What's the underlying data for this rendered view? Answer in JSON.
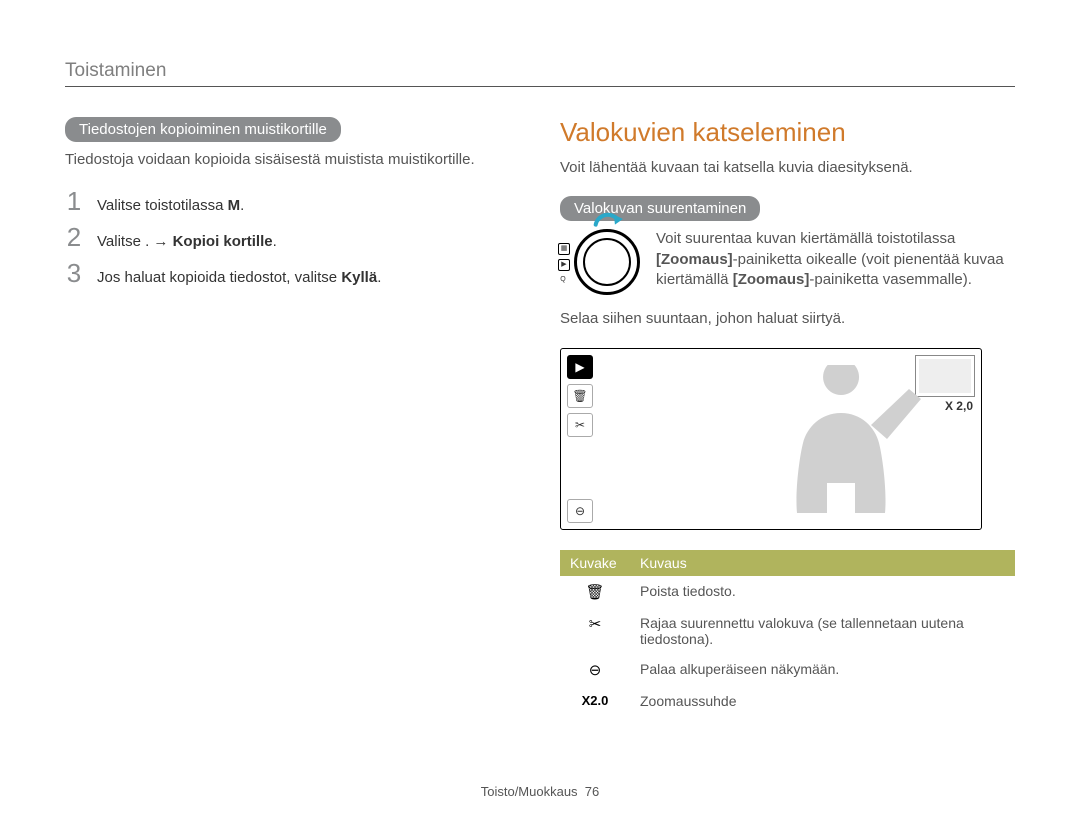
{
  "page_header": "Toistaminen",
  "footer_label": "Toisto/Muokkaus",
  "page_number": "76",
  "left": {
    "pill": "Tiedostojen kopioiminen muistikortille",
    "intro": "Tiedostoja voidaan kopioida sisäisestä muistista muistikortille.",
    "steps": {
      "s1_num": "1",
      "s1_a": "Valitse toistotilassa ",
      "s1_b": "M",
      "s1_c": ".",
      "s2_num": "2",
      "s2_a": "Valitse . → ",
      "s2_b": "Kopioi kortille",
      "s2_c": ".",
      "s3_num": "3",
      "s3_a": "Jos haluat kopioida tiedostot, valitse ",
      "s3_b": "Kyllä",
      "s3_c": "."
    }
  },
  "right": {
    "title": "Valokuvien katseleminen",
    "intro": "Voit lähentää kuvaan tai katsella kuvia diaesityksenä.",
    "pill": "Valokuvan suurentaminen",
    "zoom_text_a": "Voit suurentaa kuvan kiertämällä toistotilassa ",
    "zoom_text_b": "[Zoomaus]",
    "zoom_text_c": "-painiketta oikealle (voit pienentää kuvaa kiertämällä ",
    "zoom_text_d": "[Zoomaus]",
    "zoom_text_e": "-painiketta vasemmalle).",
    "zoom_scroll": "Selaa siihen suuntaan, johon haluat siirtyä.",
    "zoom_ratio": "X 2,0",
    "table": {
      "th_icon": "Kuvake",
      "th_desc": "Kuvaus",
      "rows": [
        {
          "iconName": "trash-icon",
          "iconGlyph": "🗑",
          "desc": "Poista tiedosto."
        },
        {
          "iconName": "crop-icon",
          "iconGlyph": "✂",
          "desc": "Rajaa suurennettu valokuva (se tallennetaan uutena tiedostona)."
        },
        {
          "iconName": "zoom-reset-icon",
          "iconGlyph": "⊖",
          "desc": "Palaa alkuperäiseen näkymään."
        },
        {
          "iconName": "zoom-ratio-label",
          "iconGlyph": "X2.0",
          "desc": "Zoomaussuhde"
        }
      ]
    }
  }
}
